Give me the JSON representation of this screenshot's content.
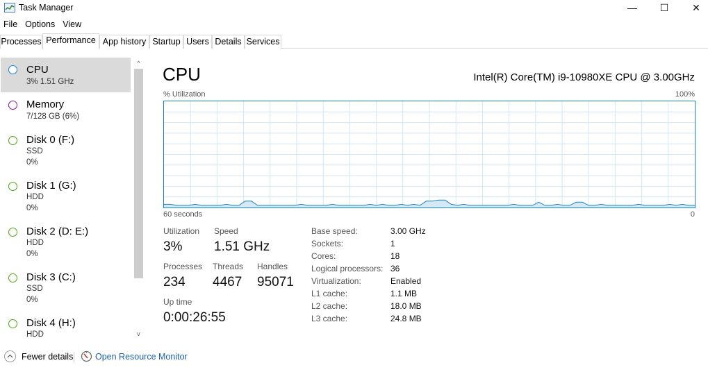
{
  "window": {
    "title": "Task Manager",
    "controls": {
      "minimize": "—",
      "maximize": "☐",
      "close": "✕"
    }
  },
  "menu": [
    "File",
    "Options",
    "View"
  ],
  "tabs": [
    {
      "label": "Processes",
      "active": false
    },
    {
      "label": "Performance",
      "active": true
    },
    {
      "label": "App history",
      "active": false
    },
    {
      "label": "Startup",
      "active": false
    },
    {
      "label": "Users",
      "active": false
    },
    {
      "label": "Details",
      "active": false
    },
    {
      "label": "Services",
      "active": false
    }
  ],
  "sidebar": {
    "items": [
      {
        "title": "CPU",
        "sub1": "3% 1.51 GHz",
        "sub2": "",
        "color": "#1783c7",
        "selected": true
      },
      {
        "title": "Memory",
        "sub1": "7/128 GB (6%)",
        "sub2": "",
        "color": "#8b12ae",
        "selected": false
      },
      {
        "title": "Disk 0 (F:)",
        "sub1": "SSD",
        "sub2": "0%",
        "color": "#4da60c",
        "selected": false
      },
      {
        "title": "Disk 1 (G:)",
        "sub1": "HDD",
        "sub2": "0%",
        "color": "#4da60c",
        "selected": false
      },
      {
        "title": "Disk 2 (D: E:)",
        "sub1": "HDD",
        "sub2": "0%",
        "color": "#4da60c",
        "selected": false
      },
      {
        "title": "Disk 3 (C:)",
        "sub1": "SSD",
        "sub2": "0%",
        "color": "#4da60c",
        "selected": false
      },
      {
        "title": "Disk 4 (H:)",
        "sub1": "HDD",
        "sub2": "",
        "color": "#4da60c",
        "selected": false
      }
    ],
    "scroll_up": "^",
    "scroll_down": "v"
  },
  "main": {
    "title": "CPU",
    "model": "Intel(R) Core(TM) i9-10980XE CPU @ 3.00GHz",
    "graph": {
      "y_label": "% Utilization",
      "y_max_label": "100%",
      "x_left_label": "60 seconds",
      "x_right_label": "0",
      "line_color": "#1783c7",
      "fill_color": "#d7e8f5",
      "grid_color": "#d4e6f3",
      "series": [
        3,
        3,
        2,
        2,
        2,
        3,
        2,
        2,
        2,
        2,
        3,
        2,
        2,
        6,
        6,
        2,
        2,
        2,
        2,
        2,
        2,
        2,
        3,
        2,
        2,
        2,
        2,
        3,
        2,
        2,
        2,
        2,
        2,
        3,
        2,
        3,
        2,
        2,
        3,
        2,
        3,
        2,
        6,
        6,
        7,
        7,
        3,
        2,
        3,
        2,
        2,
        2,
        2,
        2,
        2,
        2,
        3,
        2,
        2,
        2,
        5,
        2,
        2,
        3,
        2,
        2,
        5,
        5,
        2,
        2,
        3,
        2,
        2,
        2,
        2,
        2,
        3,
        2,
        2,
        2,
        2,
        3,
        2,
        3,
        2,
        2
      ]
    },
    "stats": {
      "utilization": {
        "label": "Utilization",
        "value": "3%"
      },
      "speed": {
        "label": "Speed",
        "value": "1.51 GHz"
      },
      "processes": {
        "label": "Processes",
        "value": "234"
      },
      "threads": {
        "label": "Threads",
        "value": "4467"
      },
      "handles": {
        "label": "Handles",
        "value": "95071"
      },
      "uptime": {
        "label": "Up time",
        "value": "0:00:26:55"
      }
    },
    "specs": [
      {
        "label": "Base speed:",
        "value": "3.00 GHz"
      },
      {
        "label": "Sockets:",
        "value": "1"
      },
      {
        "label": "Cores:",
        "value": "18"
      },
      {
        "label": "Logical processors:",
        "value": "36"
      },
      {
        "label": "Virtualization:",
        "value": "Enabled"
      },
      {
        "label": "L1 cache:",
        "value": "1.1 MB"
      },
      {
        "label": "L2 cache:",
        "value": "18.0 MB"
      },
      {
        "label": "L3 cache:",
        "value": "24.8 MB"
      }
    ]
  },
  "footer": {
    "fewer_details": "Fewer details",
    "fewer_icon": "chevron-up-icon",
    "resource_monitor": "Open Resource Monitor",
    "resource_icon": "resource-monitor-icon"
  }
}
